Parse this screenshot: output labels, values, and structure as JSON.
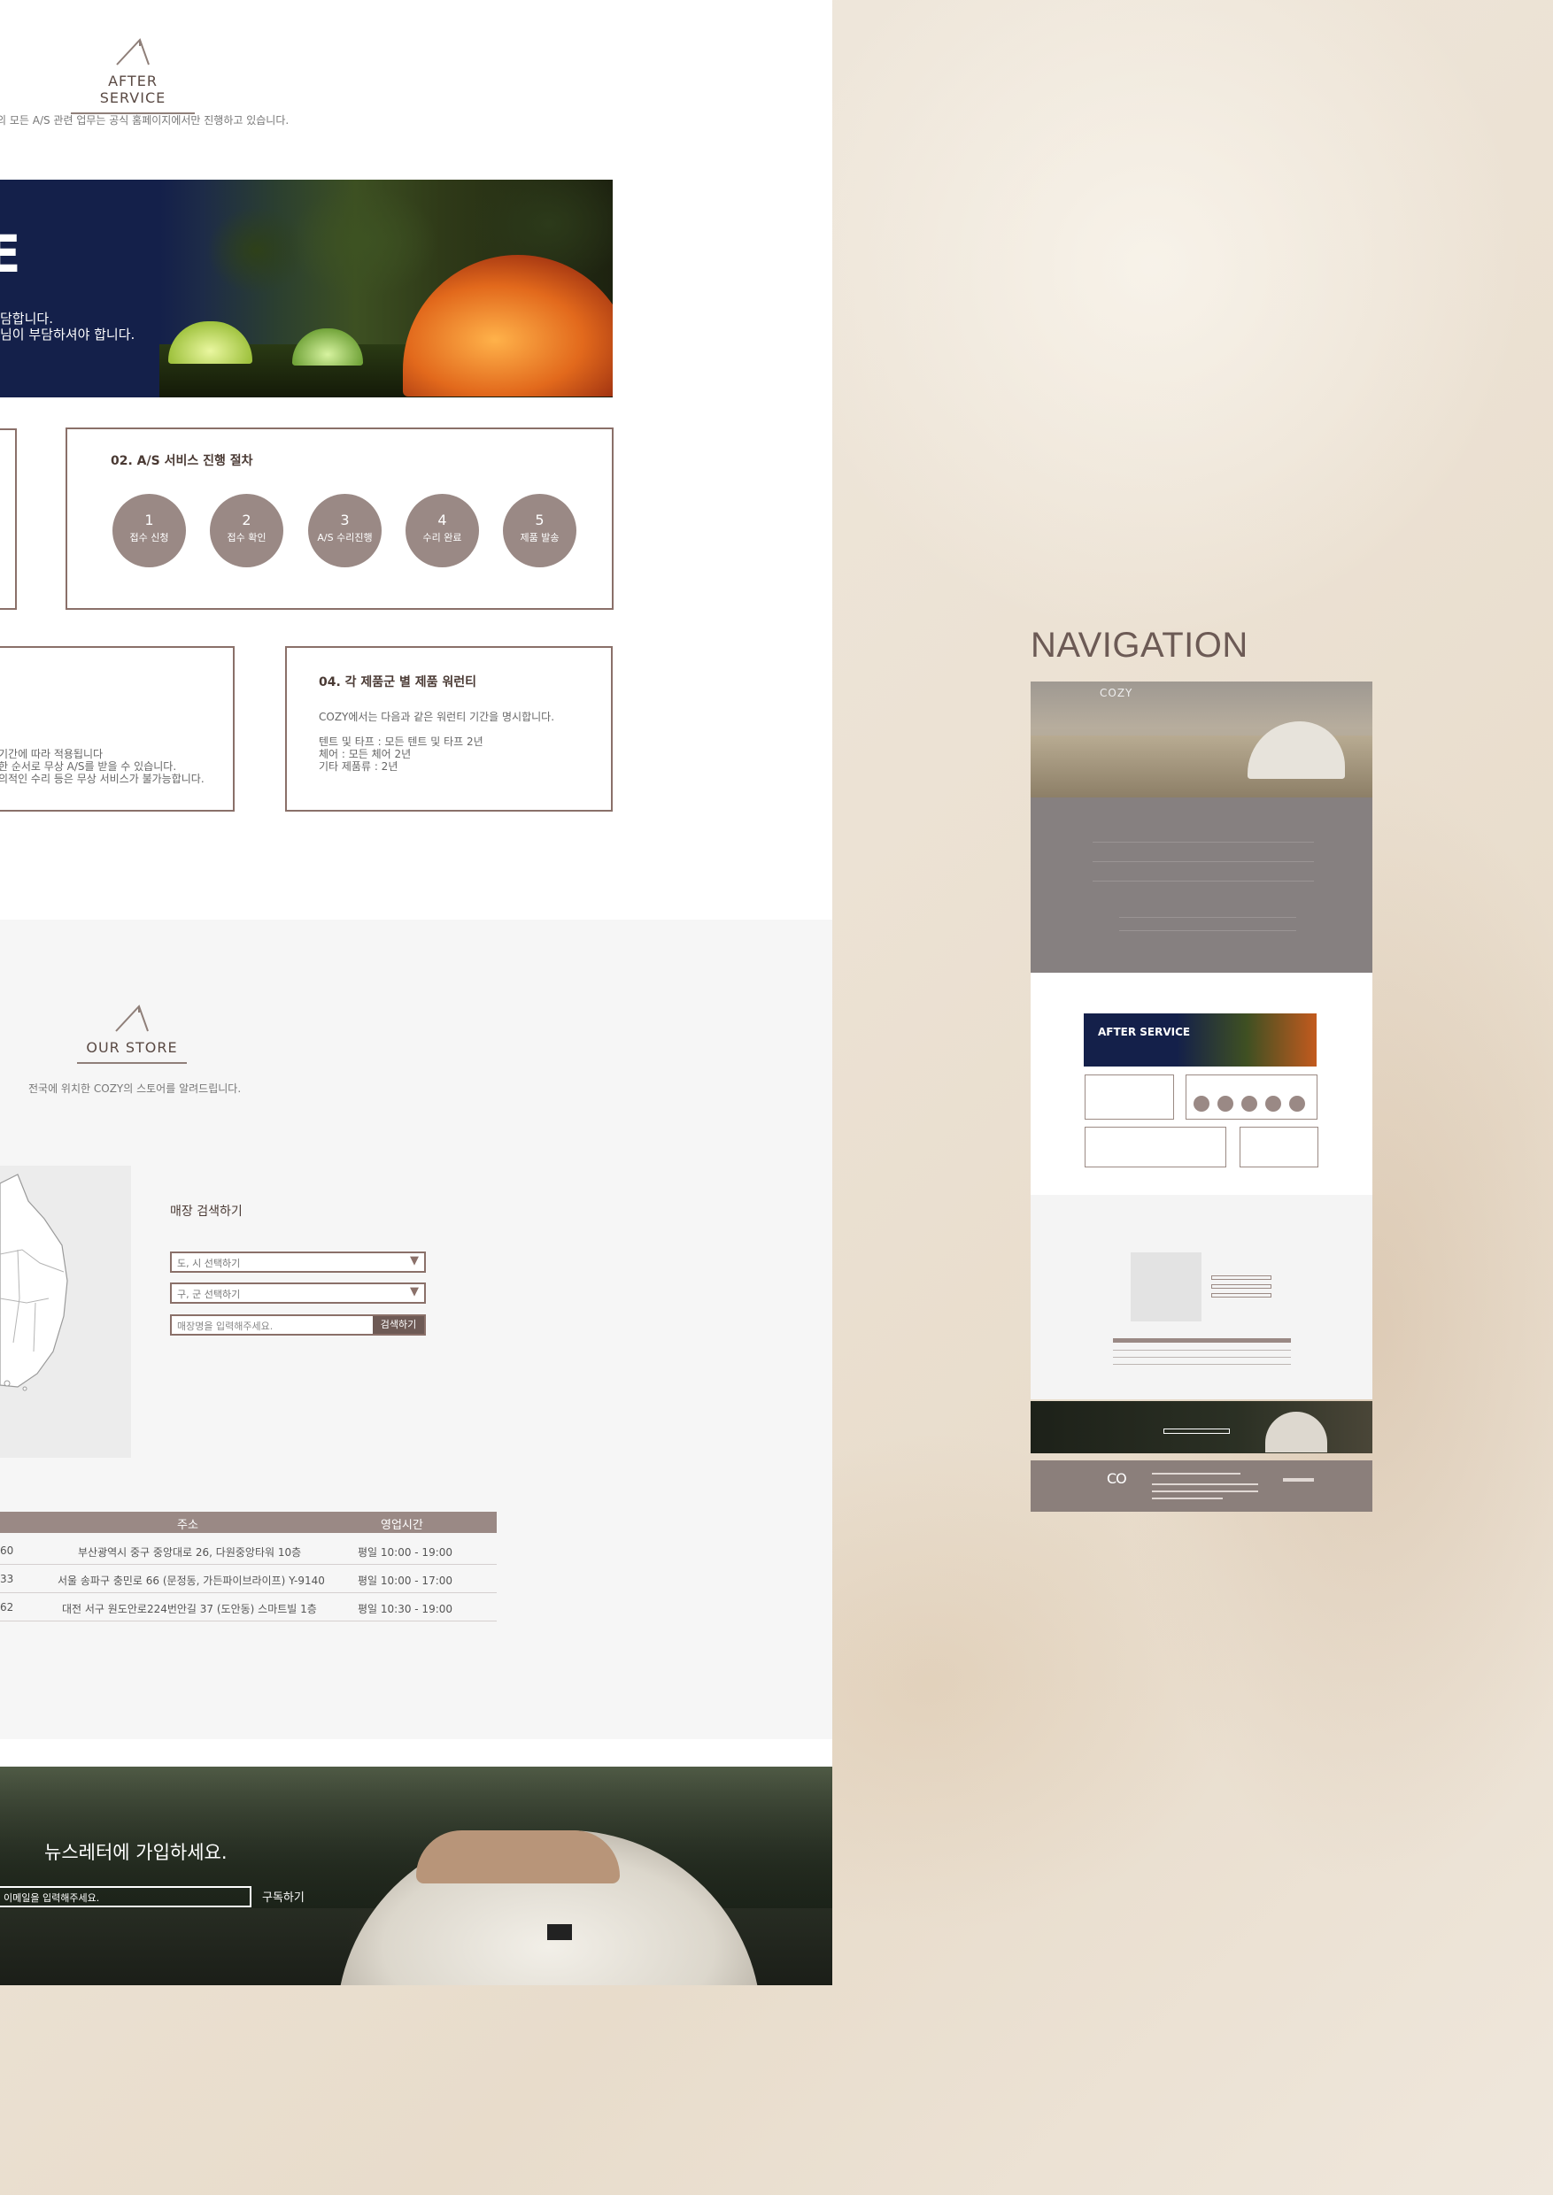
{
  "after_service": {
    "title": "AFTER SERVICE",
    "subtitle": "의 모든 A/S 관련 업무는 공식 홈페이지에서만 진행하고 있습니다.",
    "hero_letter": "E",
    "hero_line1": "담합니다.",
    "hero_line2": "님이 부담하셔야 합니다.",
    "process": {
      "title": "02. A/S 서비스 진행 절차",
      "steps": [
        {
          "num": "1",
          "label": "접수 신청"
        },
        {
          "num": "2",
          "label": "접수 확인"
        },
        {
          "num": "3",
          "label": "A/S 수리진행"
        },
        {
          "num": "4",
          "label": "수리 완료"
        },
        {
          "num": "5",
          "label": "제품 발송"
        }
      ]
    },
    "left_box_lines": [
      "기간에 따라 적용됩니다",
      "한 순서로 무상 A/S를 받을 수 있습니다.",
      "의적인 수리 등은 무상 서비스가 불가능합니다."
    ],
    "warranty": {
      "title": "04. 각 제품군 별 제품 워런티",
      "intro": "COZY에서는 다음과 같은 워런티 기간을 명시합니다.",
      "lines": [
        "텐트 및 타프 : 모든 텐트 및 타프 2년",
        "체어 : 모든 체어 2년",
        "기타 제품류 : 2년"
      ]
    }
  },
  "our_store": {
    "title": "OUR STORE",
    "subtitle": "전국에 위치한 COZY의 스토어를 알려드립니다.",
    "search_title": "매장 검색하기",
    "select_province": "도, 시 선택하기",
    "select_district": "구, 군 선택하기",
    "search_placeholder": "매장명을 입력해주세요.",
    "search_button": "검색하기",
    "table": {
      "headers": [
        "주소",
        "영업시간"
      ],
      "rows": [
        {
          "phone": "60",
          "address": "부산광역시 중구 중앙대로 26, 다원중앙타워 10층",
          "hours": "평일 10:00 - 19:00"
        },
        {
          "phone": "33",
          "address": "서울 송파구 충민로 66 (문정동, 가든파이브라이프) Y-9140",
          "hours": "평일 10:00 - 17:00"
        },
        {
          "phone": "62",
          "address": "대전 서구 원도안로224번안길 37 (도안동) 스마트빌 1층",
          "hours": "평일 10:30 - 19:00"
        }
      ]
    }
  },
  "newsletter": {
    "title": "뉴스레터에 가입하세요.",
    "input_placeholder": "이메일을 입력해주세요.",
    "button": "구독하기"
  },
  "navigation": {
    "title": "NAVIGATION",
    "thumb_logo": "COZY",
    "thumb_as_label": "AFTER SERVICE",
    "footer_logo": "CO"
  },
  "colors": {
    "accent": "#8a7069",
    "circle": "#9a8985",
    "navy": "#14204a",
    "footer": "#8b7f7b"
  }
}
